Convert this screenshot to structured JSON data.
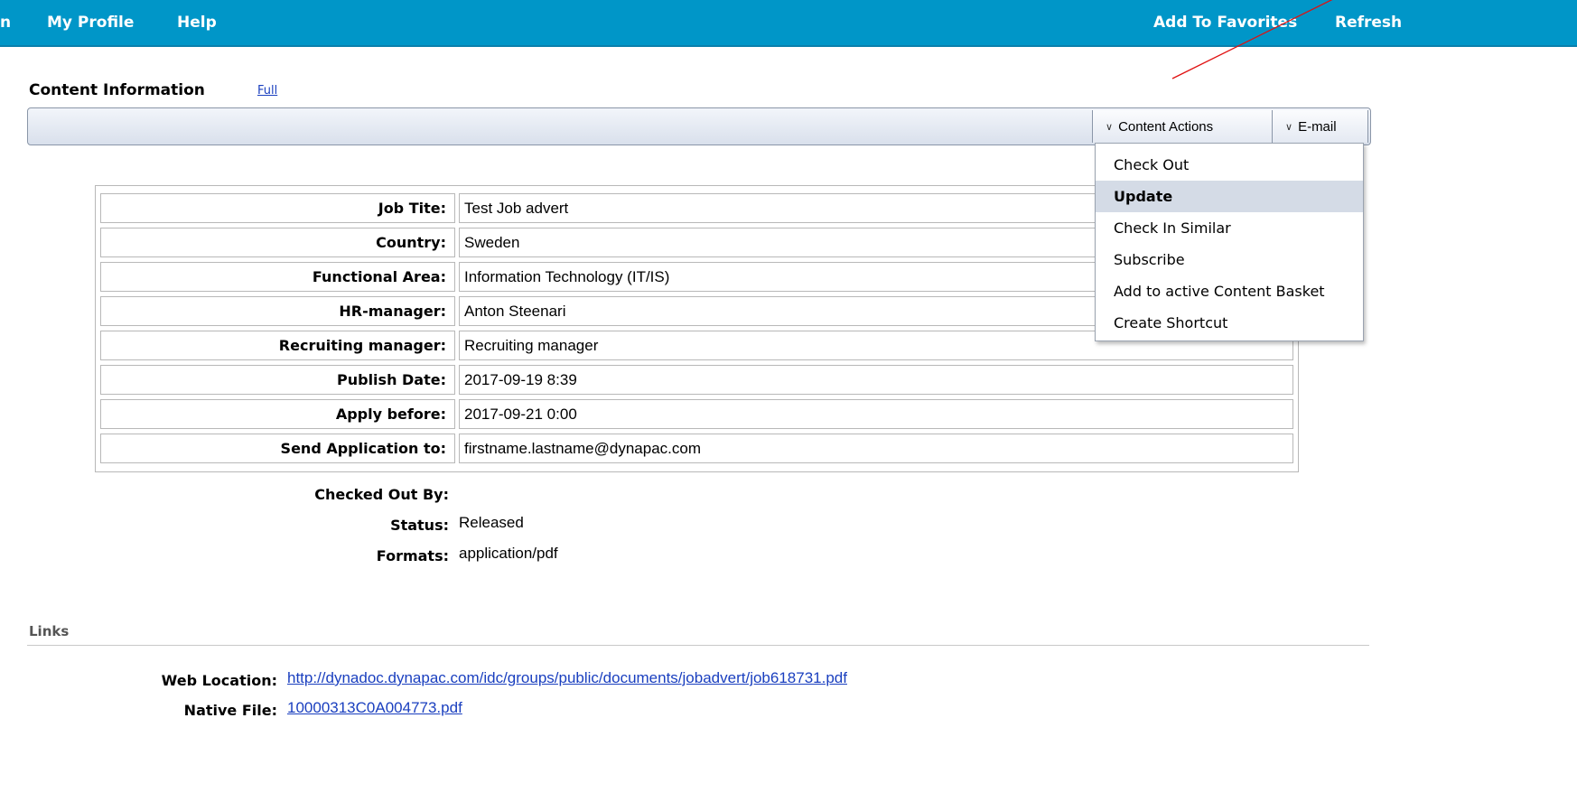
{
  "nav": {
    "partial_left": "n",
    "my_profile": "My Profile",
    "help": "Help",
    "add_to_favorites": "Add To Favorites",
    "refresh": "Refresh"
  },
  "header": {
    "title": "Content Information",
    "full_link": "Full"
  },
  "toolbar": {
    "content_actions": "Content Actions",
    "email": "E-mail"
  },
  "dropdown": {
    "items": [
      {
        "label": "Check Out"
      },
      {
        "label": "Update",
        "highlighted": true
      },
      {
        "label": "Check In Similar"
      },
      {
        "label": "Subscribe"
      },
      {
        "label": "Add to active Content Basket"
      },
      {
        "label": "Create Shortcut"
      }
    ]
  },
  "metadata": {
    "rows": [
      {
        "label": "Job Tite:",
        "value": "Test Job advert"
      },
      {
        "label": "Country:",
        "value": "Sweden"
      },
      {
        "label": "Functional Area:",
        "value": "Information Technology (IT/IS)"
      },
      {
        "label": "HR-manager:",
        "value": "Anton Steenari"
      },
      {
        "label": "Recruiting manager:",
        "value": "Recruiting manager"
      },
      {
        "label": "Publish Date:",
        "value": "2017-09-19 8:39"
      },
      {
        "label": "Apply before:",
        "value": "2017-09-21 0:00"
      },
      {
        "label": "Send Application to:",
        "value": "firstname.lastname@dynapac.com"
      }
    ]
  },
  "fields": {
    "checked_out_by": {
      "label": "Checked Out By:",
      "value": ""
    },
    "status": {
      "label": "Status:",
      "value": "Released"
    },
    "formats": {
      "label": "Formats:",
      "value": "application/pdf"
    }
  },
  "links": {
    "header": "Links",
    "web_location": {
      "label": "Web Location:",
      "value": "http://dynadoc.dynapac.com/idc/groups/public/documents/jobadvert/job618731.pdf"
    },
    "native_file": {
      "label": "Native File:",
      "value": "10000313C0A004773.pdf"
    }
  },
  "colors": {
    "topbar": "#0096c8",
    "dropdown_highlight": "#d4dbe6",
    "link": "#1a3fbf",
    "annotation_line": "#e01010"
  }
}
